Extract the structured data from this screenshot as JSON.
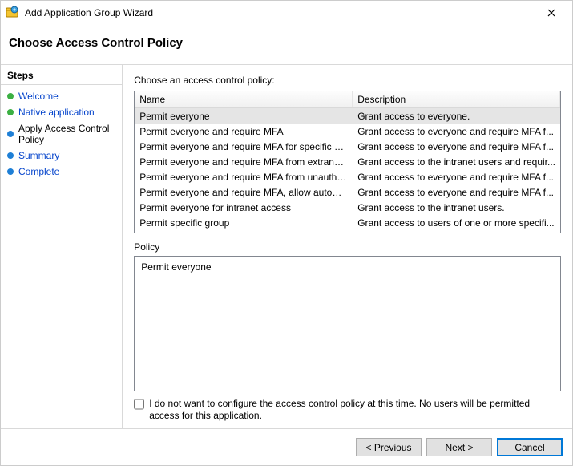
{
  "window": {
    "title": "Add Application Group Wizard"
  },
  "header": {
    "title": "Choose Access Control Policy"
  },
  "sidebar": {
    "header": "Steps",
    "items": [
      {
        "label": "Welcome",
        "state": "done",
        "link": true
      },
      {
        "label": "Native application",
        "state": "done",
        "link": true
      },
      {
        "label": "Apply Access Control Policy",
        "state": "current",
        "link": false
      },
      {
        "label": "Summary",
        "state": "future",
        "link": true
      },
      {
        "label": "Complete",
        "state": "future",
        "link": true
      }
    ]
  },
  "main": {
    "instruction": "Choose an access control policy:",
    "columns": {
      "name": "Name",
      "desc": "Description"
    },
    "rows": [
      {
        "name": "Permit everyone",
        "desc": "Grant access to everyone.",
        "selected": true
      },
      {
        "name": "Permit everyone and require MFA",
        "desc": "Grant access to everyone and require MFA f..."
      },
      {
        "name": "Permit everyone and require MFA for specific group",
        "desc": "Grant access to everyone and require MFA f..."
      },
      {
        "name": "Permit everyone and require MFA from extranet access",
        "desc": "Grant access to the intranet users and requir..."
      },
      {
        "name": "Permit everyone and require MFA from unauthenticated ...",
        "desc": "Grant access to everyone and require MFA f..."
      },
      {
        "name": "Permit everyone and require MFA, allow automatic devi...",
        "desc": "Grant access to everyone and require MFA f..."
      },
      {
        "name": "Permit everyone for intranet access",
        "desc": "Grant access to the intranet users."
      },
      {
        "name": "Permit specific group",
        "desc": "Grant access to users of one or more specifi..."
      }
    ],
    "policy_label": "Policy",
    "policy_value": "Permit everyone",
    "skip_checkbox_label": "I do not want to configure the access control policy at this time.  No users will be permitted access for this application."
  },
  "footer": {
    "previous": "< Previous",
    "next": "Next >",
    "cancel": "Cancel"
  }
}
